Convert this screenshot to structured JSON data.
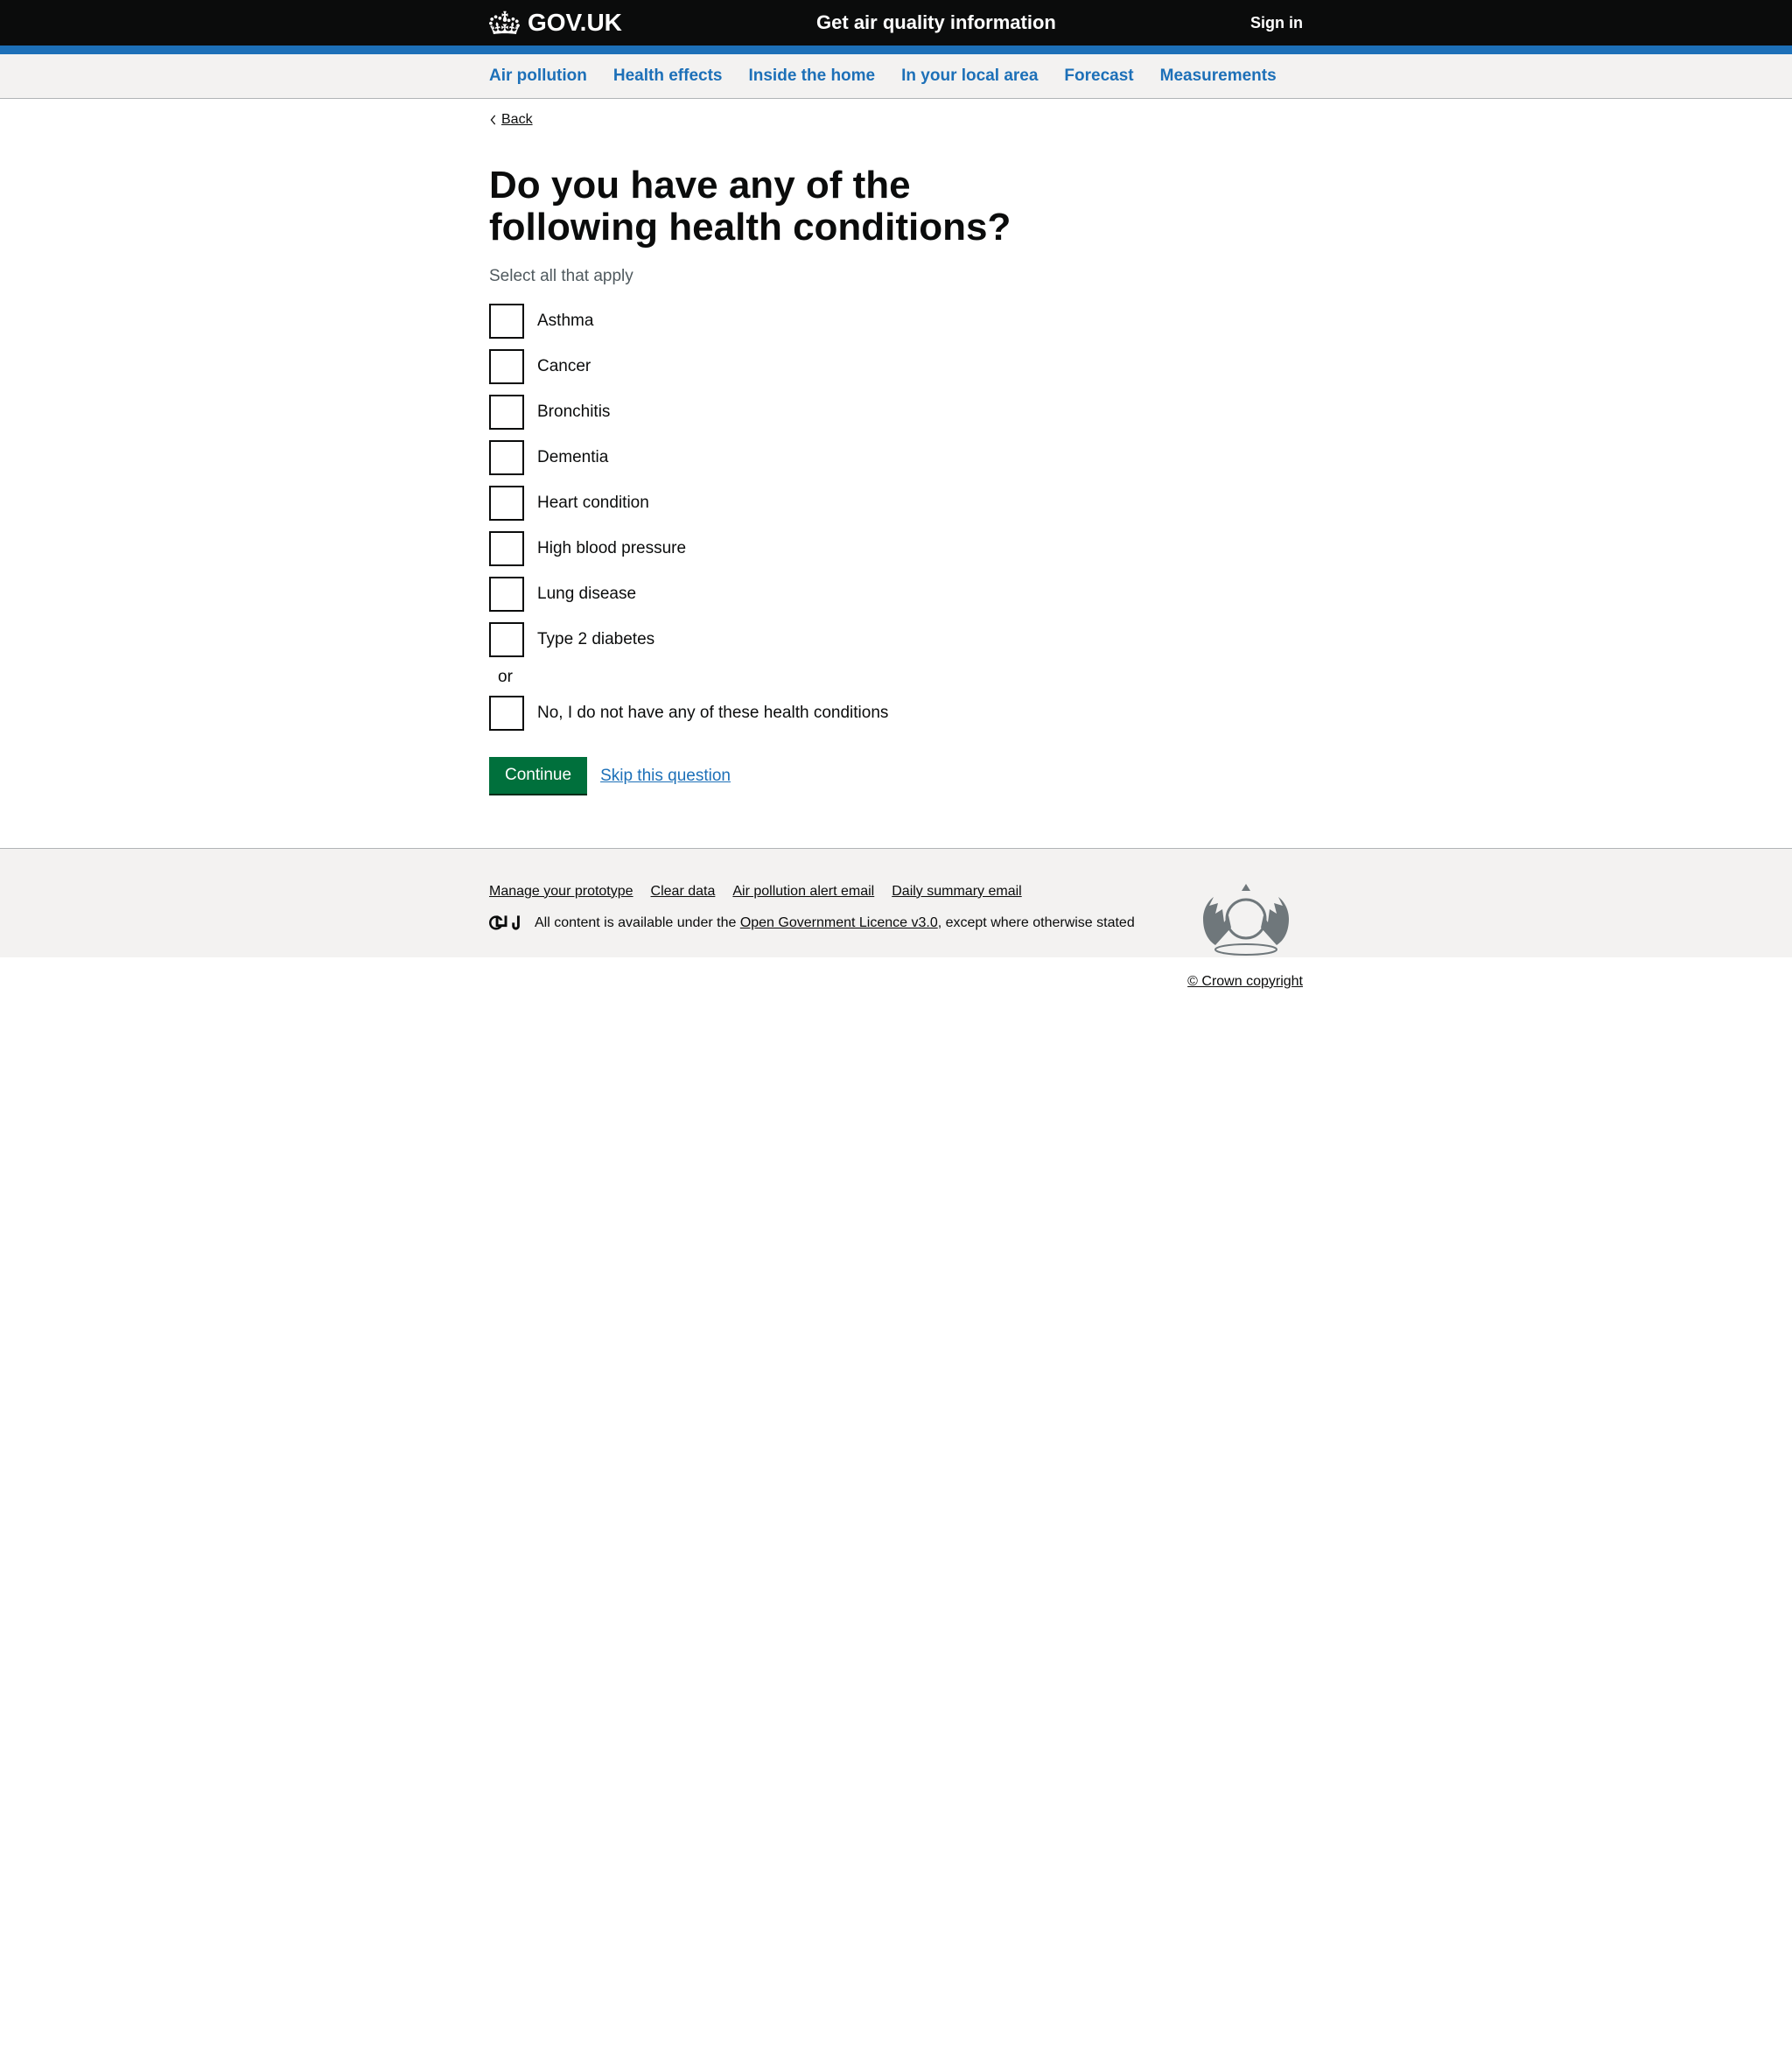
{
  "header": {
    "logo_text": "GOV.UK",
    "service_title": "Get air quality information",
    "signin": "Sign in"
  },
  "nav": {
    "items": [
      "Air pollution",
      "Health effects",
      "Inside the home",
      "In your local area",
      "Forecast",
      "Measurements"
    ]
  },
  "back": "Back",
  "question": {
    "heading": "Do you have any of the following health conditions?",
    "hint": "Select all that apply",
    "options": [
      "Asthma",
      "Cancer",
      "Bronchitis",
      "Dementia",
      "Heart condition",
      "High blood pressure",
      "Lung disease",
      "Type 2 diabetes"
    ],
    "divider": "or",
    "none_option": "No, I do not have any of these health conditions"
  },
  "actions": {
    "continue": "Continue",
    "skip": "Skip this question"
  },
  "footer": {
    "links": [
      "Manage your prototype",
      "Clear data",
      "Air pollution alert email",
      "Daily summary email"
    ],
    "licence_prefix": "All content is available under the ",
    "licence_link": "Open Government Licence v3.0",
    "licence_suffix": ", except where otherwise stated",
    "crown": "© Crown copyright"
  }
}
